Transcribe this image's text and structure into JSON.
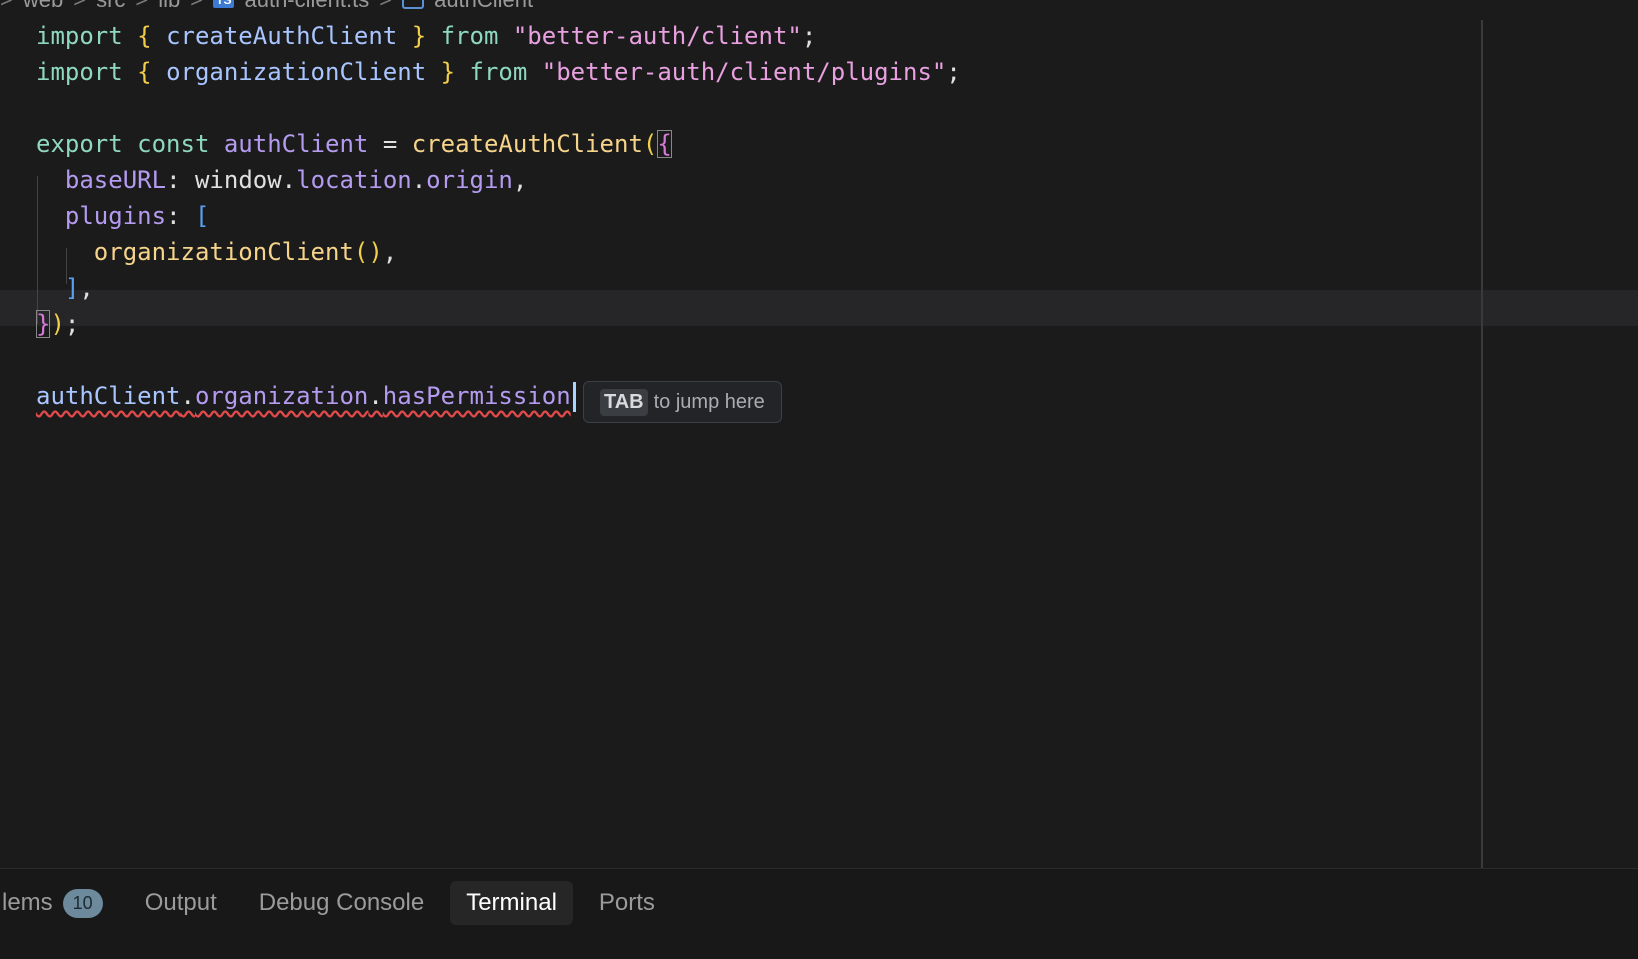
{
  "breadcrumb": {
    "items": [
      "web",
      "src",
      "lib",
      "auth-client.ts",
      "authClient"
    ],
    "sep": ">",
    "ts_badge": "TS"
  },
  "code": {
    "line1": {
      "kw_import": "import",
      "brace_open": "{",
      "name": "createAuthClient",
      "brace_close": "}",
      "kw_from": "from",
      "str": "\"better-auth/client\"",
      "semi": ";"
    },
    "line2": {
      "kw_import": "import",
      "brace_open": "{",
      "name": "organizationClient",
      "brace_close": "}",
      "kw_from": "from",
      "str": "\"better-auth/client/plugins\"",
      "semi": ";"
    },
    "line4": {
      "kw_export": "export",
      "kw_const": "const",
      "var": "authClient",
      "eq": "=",
      "fn": "createAuthClient",
      "paren": "(",
      "brace": "{"
    },
    "line5": {
      "prop": "baseURL",
      "colon": ":",
      "obj": "window",
      "dot1": ".",
      "prop2": "location",
      "dot2": ".",
      "prop3": "origin",
      "comma": ","
    },
    "line6": {
      "prop": "plugins",
      "colon": ":",
      "bracket": "["
    },
    "line7": {
      "fn": "organizationClient",
      "parens": "()",
      "comma": ","
    },
    "line8": {
      "bracket": "]",
      "comma": ","
    },
    "line9": {
      "brace": "}",
      "paren": ")",
      "semi": ";"
    },
    "line11": {
      "var": "authClient",
      "dot1": ".",
      "prop": "organization",
      "dot2": ".",
      "method": "hasPermission"
    }
  },
  "hint": {
    "key": "TAB",
    "text": "to jump here"
  },
  "panel": {
    "tabs": [
      {
        "label": "Problems",
        "visible_label": "lems",
        "badge": "10"
      },
      {
        "label": "Output"
      },
      {
        "label": "Debug Console"
      },
      {
        "label": "Terminal",
        "active": true
      },
      {
        "label": "Ports"
      }
    ]
  },
  "colors": {
    "background": "#1b1b1c",
    "keyword": "#8fd8c0",
    "string": "#e9a0e0",
    "function": "#f6d48a",
    "variable": "#b59bef"
  }
}
